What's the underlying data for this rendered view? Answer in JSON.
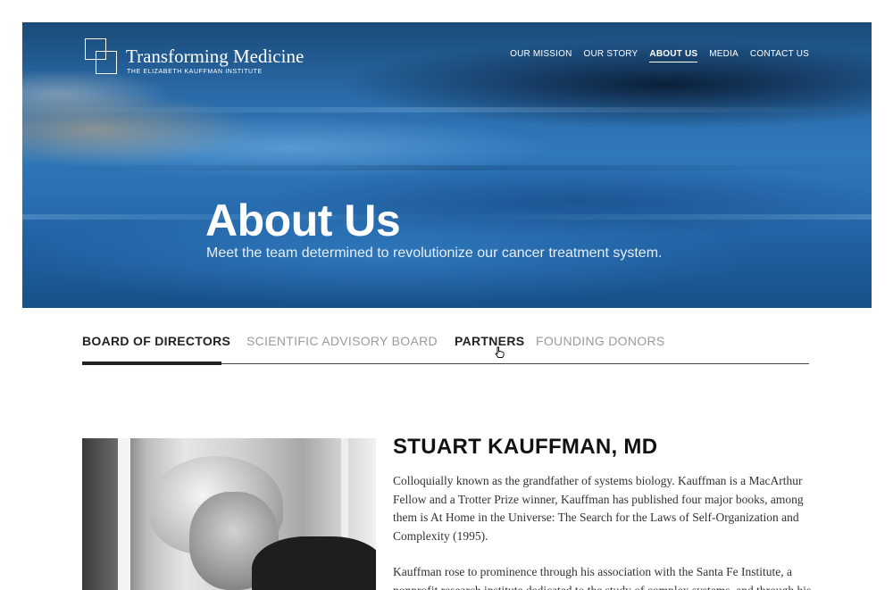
{
  "header": {
    "logo_title": "Transforming Medicine",
    "logo_subtitle": "THE ELIZABETH KAUFFMAN INSTITUTE",
    "nav": [
      {
        "label": "OUR MISSION"
      },
      {
        "label": "OUR STORY"
      },
      {
        "label": "ABOUT US",
        "active": true
      },
      {
        "label": "MEDIA"
      },
      {
        "label": "CONTACT US"
      }
    ]
  },
  "hero": {
    "title": "About Us",
    "subtitle": "Meet the team determined to revolutionize our cancer treatment system."
  },
  "tabs": [
    {
      "label": "BOARD OF DIRECTORS",
      "active": true
    },
    {
      "label": "SCIENTIFIC ADVISORY BOARD"
    },
    {
      "label": "PARTNERS",
      "hovered": true
    },
    {
      "label": "FOUNDING DONORS"
    }
  ],
  "profile": {
    "name": "STUART KAUFFMAN, MD",
    "bio_1": "Colloquially known as the grandfather of systems biology. Kauffman is a MacArthur Fellow and a Trotter Prize winner, Kauffman has published four major books, among them is At Home in the Universe: The Search for the Laws of Self-Organization and Complexity (1995).",
    "bio_2": "Kauffman rose to prominence through his association with the Santa Fe Institute, a nonprofit research institute dedicated to the study of complex systems, and through his"
  },
  "colors": {
    "active_text": "#222222",
    "inactive_text": "#9b9b9b",
    "hero_blue": "#2a70b2"
  },
  "icons": {
    "cursor": "hand-pointer-icon"
  }
}
